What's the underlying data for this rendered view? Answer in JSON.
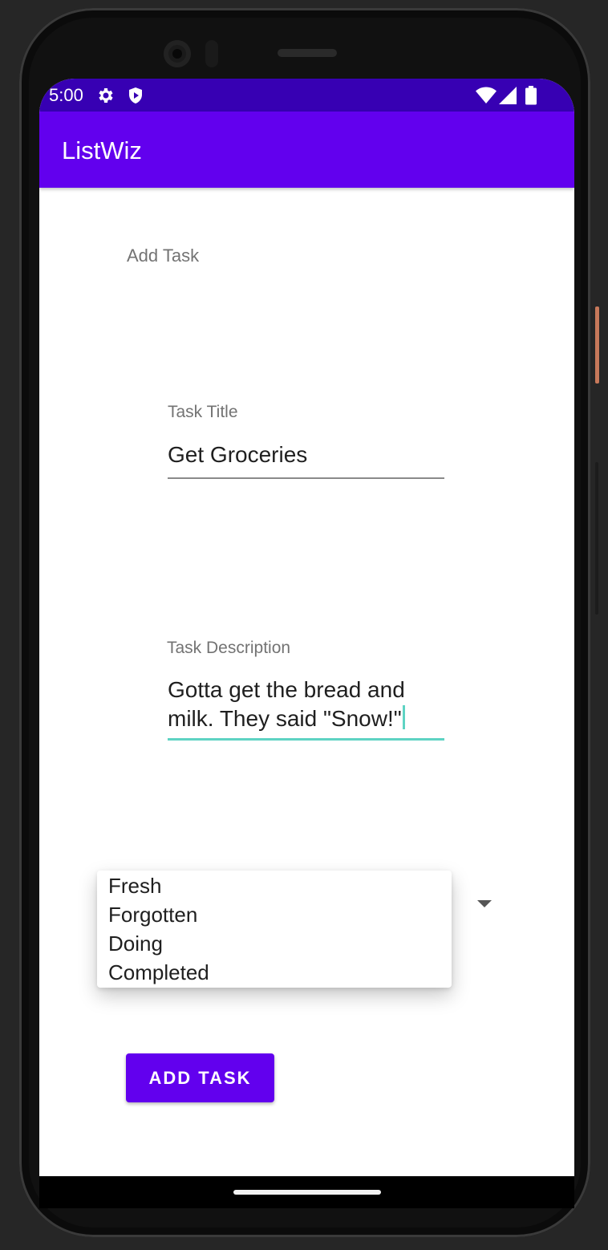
{
  "status_bar": {
    "time": "5:00",
    "icons": [
      "gear-icon",
      "shield-icon",
      "wifi-icon",
      "signal-icon",
      "battery-icon"
    ]
  },
  "app_bar": {
    "title": "ListWiz"
  },
  "form": {
    "section_label": "Add Task",
    "title_field": {
      "label": "Task Title",
      "value": "Get Groceries"
    },
    "description_field": {
      "label": "Task Description",
      "value_line1": "Gotta get the bread and",
      "value_line2": "milk. They said \"Snow!\""
    },
    "status_spinner": {
      "options": [
        "Fresh",
        "Forgotten",
        "Doing",
        "Completed"
      ]
    },
    "submit_label": "ADD TASK"
  },
  "colors": {
    "status_bar": "#3700b3",
    "primary": "#6200ee",
    "accent": "#5ed3c3"
  }
}
